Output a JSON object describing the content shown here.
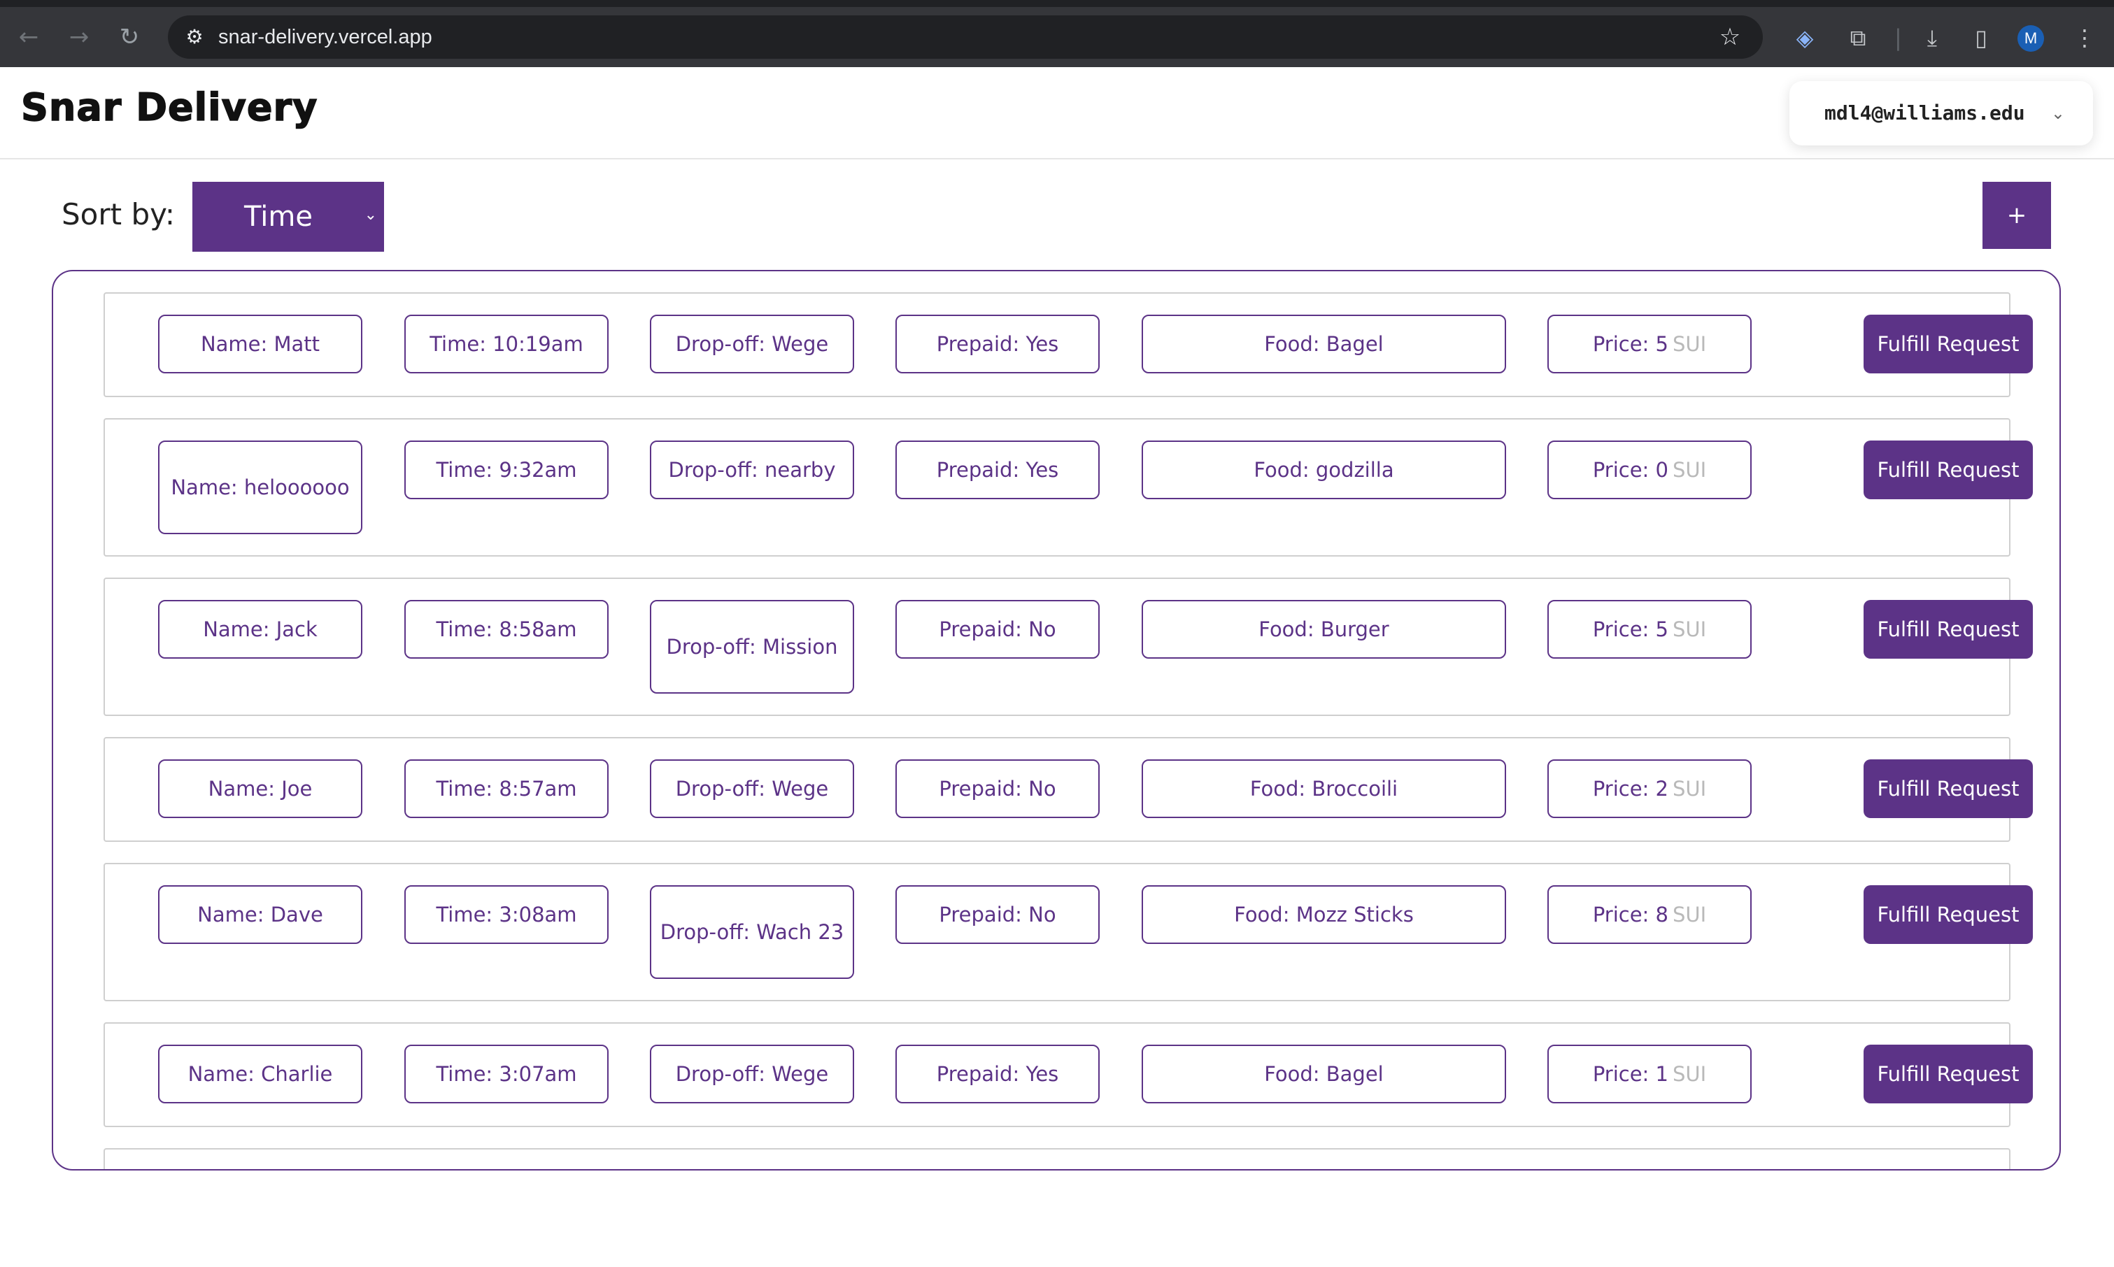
{
  "browser": {
    "url": "snar-delivery.vercel.app",
    "profile_initial": "M"
  },
  "app": {
    "logo": "Snar Delivery",
    "account_email": "mdl4@williams.edu"
  },
  "toolbar": {
    "sort_label": "Sort by:",
    "sort_value": "Time",
    "add_label": "+"
  },
  "orders": [
    {
      "name": "Name: Matt",
      "time": "Time: 10:19am",
      "dropoff": "Drop-off: Wege",
      "prepaid": "Prepaid: Yes",
      "food": "Food: Bagel",
      "price": "Price: 5",
      "unit": "SUI",
      "action": "Fulfill Request"
    },
    {
      "name": "Name: heloooooo",
      "time": "Time: 9:32am",
      "dropoff": "Drop-off: nearby",
      "prepaid": "Prepaid: Yes",
      "food": "Food: godzilla",
      "price": "Price: 0",
      "unit": "SUI",
      "action": "Fulfill Request"
    },
    {
      "name": "Name: Jack",
      "time": "Time: 8:58am",
      "dropoff": "Drop-off: Mission",
      "prepaid": "Prepaid: No",
      "food": "Food: Burger",
      "price": "Price: 5",
      "unit": "SUI",
      "action": "Fulfill Request"
    },
    {
      "name": "Name: Joe",
      "time": "Time: 8:57am",
      "dropoff": "Drop-off: Wege",
      "prepaid": "Prepaid: No",
      "food": "Food: Broccoili",
      "price": "Price: 2",
      "unit": "SUI",
      "action": "Fulfill Request"
    },
    {
      "name": "Name: Dave",
      "time": "Time: 3:08am",
      "dropoff": "Drop-off: Wach 23",
      "prepaid": "Prepaid: No",
      "food": "Food: Mozz Sticks",
      "price": "Price: 8",
      "unit": "SUI",
      "action": "Fulfill Request"
    },
    {
      "name": "Name: Charlie",
      "time": "Time: 3:07am",
      "dropoff": "Drop-off: Wege",
      "prepaid": "Prepaid: Yes",
      "food": "Food: Bagel",
      "price": "Price: 1",
      "unit": "SUI",
      "action": "Fulfill Request"
    }
  ]
}
